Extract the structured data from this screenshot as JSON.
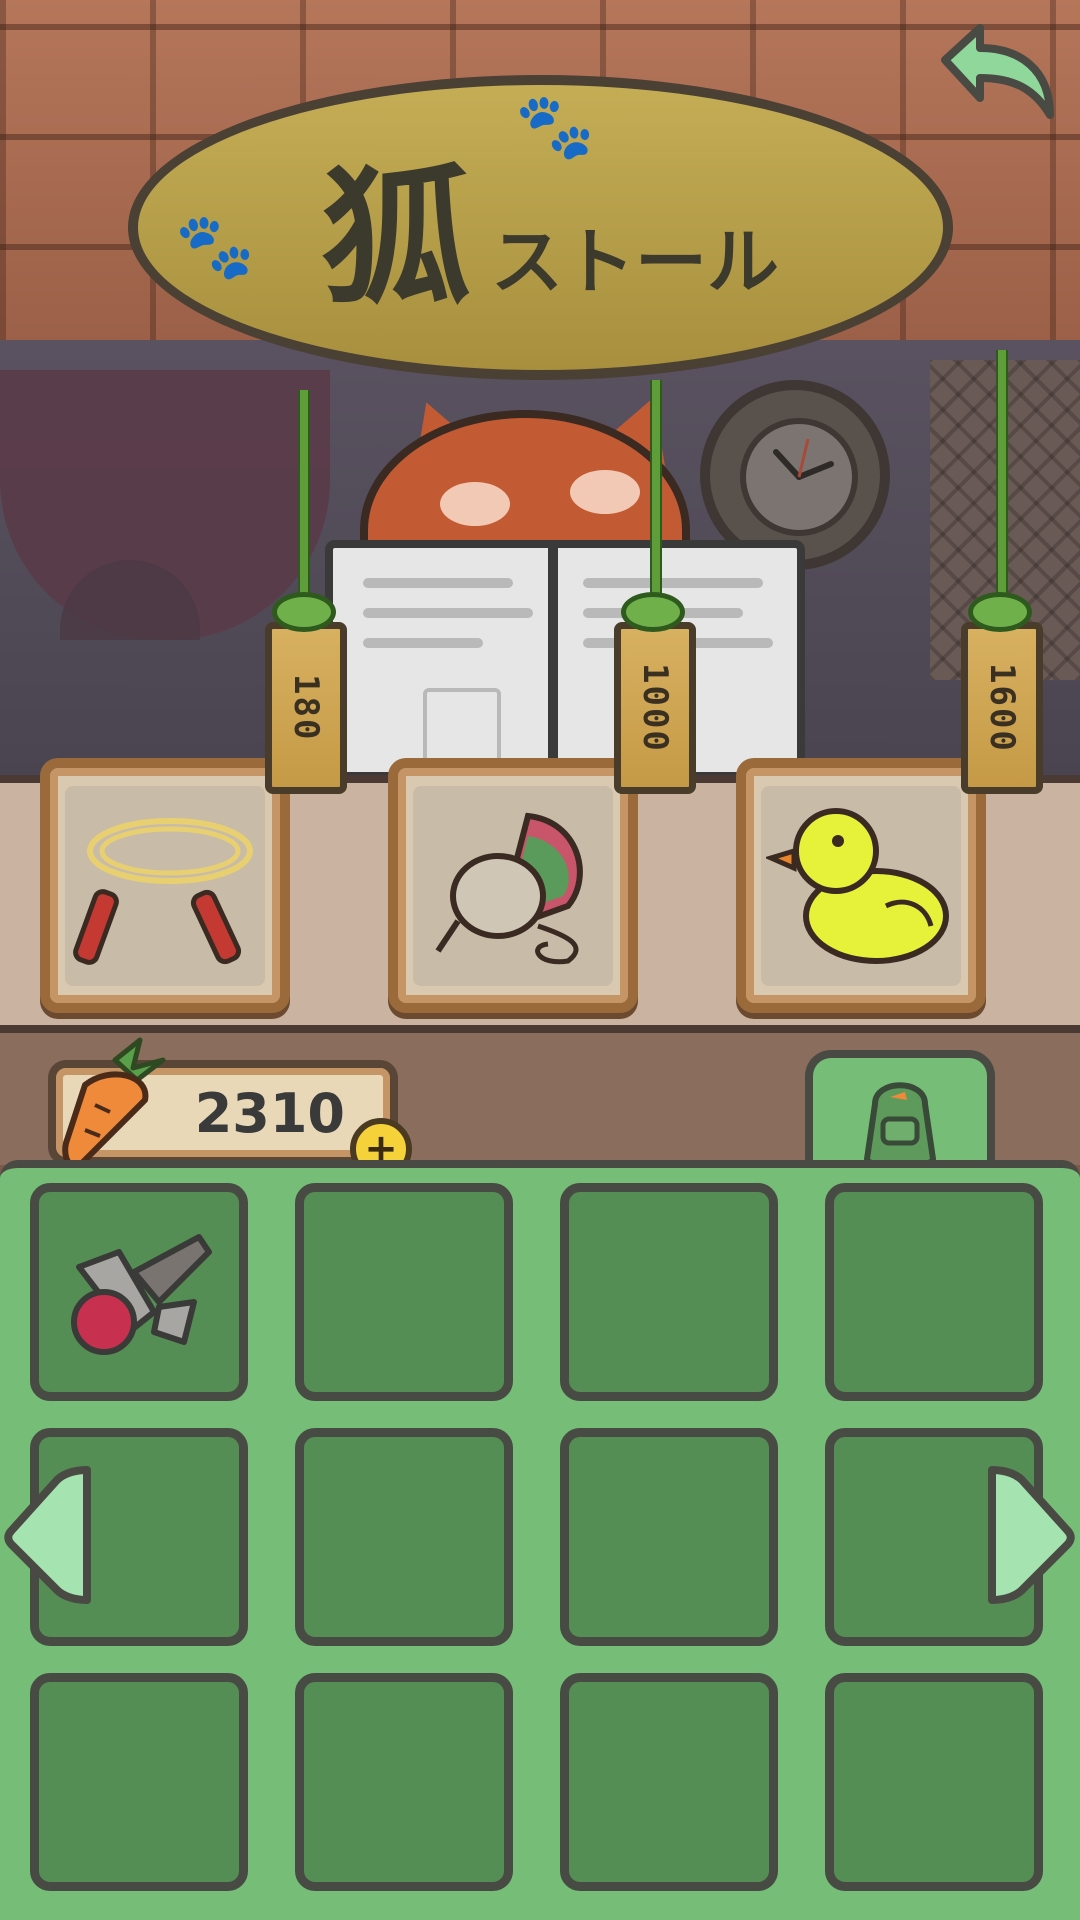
{
  "sign": {
    "title_kanji": "狐",
    "title_kana": "ストール",
    "paw_glyph": "🐾"
  },
  "shop": {
    "items": [
      {
        "name": "jump-rope",
        "price": "180"
      },
      {
        "name": "spinning-top",
        "price": "1000"
      },
      {
        "name": "rubber-duck",
        "price": "1600"
      }
    ]
  },
  "currency": {
    "amount": "2310",
    "add_glyph": "+"
  },
  "inventory": {
    "slots": [
      {
        "item": "kendama"
      },
      {
        "item": ""
      },
      {
        "item": ""
      },
      {
        "item": ""
      },
      {
        "item": ""
      },
      {
        "item": ""
      },
      {
        "item": ""
      },
      {
        "item": ""
      },
      {
        "item": ""
      },
      {
        "item": ""
      },
      {
        "item": ""
      },
      {
        "item": ""
      }
    ]
  },
  "colors": {
    "inventory_green": "#76bd78",
    "slot_green": "#558e54",
    "sign_wood": "#b49c4a",
    "fox_orange": "#c25a33",
    "duck_yellow": "#e6f23a"
  },
  "icons": {
    "back": "back-arrow-icon",
    "currency": "carrot-icon",
    "add": "plus-icon",
    "bag": "backpack-icon",
    "prev": "left-arrow-icon",
    "next": "right-arrow-icon"
  }
}
